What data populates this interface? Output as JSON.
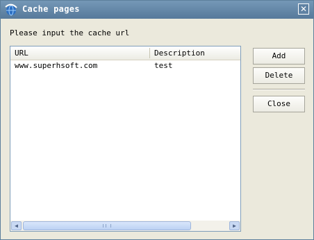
{
  "window": {
    "title": "Cache pages",
    "close_symbol": "✕"
  },
  "prompt": "Please input the cache url",
  "list": {
    "columns": [
      "URL",
      "Description"
    ],
    "rows": [
      {
        "url": "www.superhsoft.com",
        "description": "test"
      }
    ]
  },
  "buttons": {
    "add": "Add",
    "delete": "Delete",
    "close": "Close"
  },
  "scrollbar": {
    "left_arrow": "◀",
    "right_arrow": "▶"
  },
  "icons": {
    "title": "app-globe-icon"
  }
}
